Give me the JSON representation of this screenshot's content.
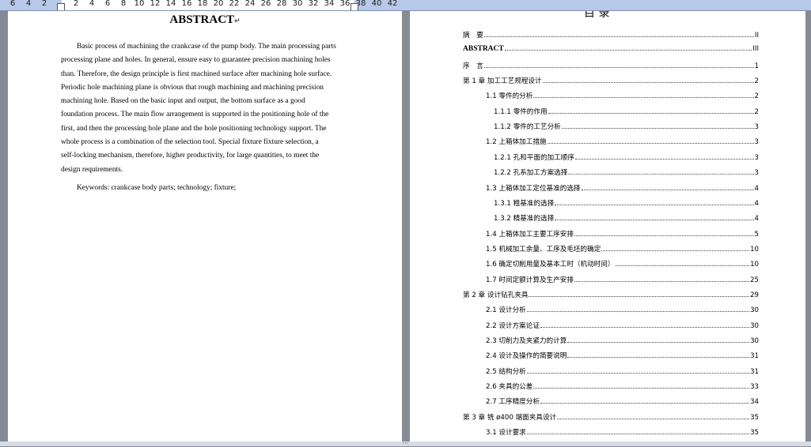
{
  "ruler": {
    "numbers": [
      "6",
      "4",
      "2",
      "2",
      "4",
      "6",
      "8",
      "10",
      "12",
      "14",
      "16",
      "18",
      "20",
      "22",
      "24",
      "26",
      "28",
      "30",
      "32",
      "34",
      "36",
      "38",
      "40",
      "42"
    ]
  },
  "abstract": {
    "title": "ABSTRACT",
    "title_mark": "↵",
    "lines": [
      "Basic process of machining the crankcase of the pump body. The main processing parts",
      "processing plane and holes. In general, ensure easy to guarantee precision machining holes",
      "than. Therefore, the design principle is first machined surface after machining hole surface.",
      "Periodic hole machining plane is obvious that rough machining and machining precision",
      "machining hole. Based on the basic input and output, the bottom surface as a good",
      "foundation process. The main flow arrangement is supported in the positioning hole of the",
      "first, and then the processing hole plane and the hole positioning technology support. The",
      "whole process is a combination of the selection tool. Special fixture fixture selection, a",
      "self-locking mechanism, therefore, higher productivity, for large quantities, to meet the",
      "design requirements."
    ],
    "keywords": "Keywords: crankcase body parts; technology; fixture;"
  },
  "toc": {
    "heading": "目  录",
    "entries": [
      {
        "label": "摘　要",
        "page": "II"
      },
      {
        "label": "ABSTRACT",
        "page": "III"
      },
      {
        "label": "序　言",
        "page": "1"
      },
      {
        "label": "第 1 章  加工工艺规程设计",
        "page": "2"
      },
      {
        "label": "1.1  零件的分析",
        "page": "2"
      },
      {
        "label": "1.1.1  零件的作用",
        "page": "2"
      },
      {
        "label": "1.1.2  零件的工艺分析",
        "page": "3"
      },
      {
        "label": "1.2  上箱体加工措施",
        "page": "3"
      },
      {
        "label": "1.2.1  孔和平面的加工顺序",
        "page": "3"
      },
      {
        "label": "1.2.2  孔系加工方案选择",
        "page": "3"
      },
      {
        "label": "1.3  上箱体加工定位基准的选择",
        "page": "4"
      },
      {
        "label": "1.3.1  粗基准的选择",
        "page": "4"
      },
      {
        "label": "1.3.2  精基准的选择",
        "page": "4"
      },
      {
        "label": "1.4  上箱体加工主要工序安排",
        "page": "5"
      },
      {
        "label": "1.5  机械加工余量、工序及毛坯的确定",
        "page": "10"
      },
      {
        "label": "1.6 确定切削用量及基本工时（机动时间）",
        "page": "10"
      },
      {
        "label": "1.7  时间定额计算及生产安排",
        "page": "25"
      },
      {
        "label": "第 2 章  设计钻孔夹具",
        "page": "29"
      },
      {
        "label": "2.1 设计分析",
        "page": "30"
      },
      {
        "label": "2.2 设计方案论证",
        "page": "30"
      },
      {
        "label": "2.3 切削力及夹紧力的计算",
        "page": "30"
      },
      {
        "label": "2.4  设计及操作的简要说明",
        "page": "31"
      },
      {
        "label": "2.5  结构分析",
        "page": "31"
      },
      {
        "label": "2.6  夹具的公差",
        "page": "33"
      },
      {
        "label": "2.7  工序精度分析",
        "page": "34"
      },
      {
        "label": "第 3 章  铣 ø400 端面夹具设计",
        "page": "35"
      },
      {
        "label": "3.1  设计要求",
        "page": "35"
      }
    ]
  },
  "status": {
    "text": "···"
  }
}
